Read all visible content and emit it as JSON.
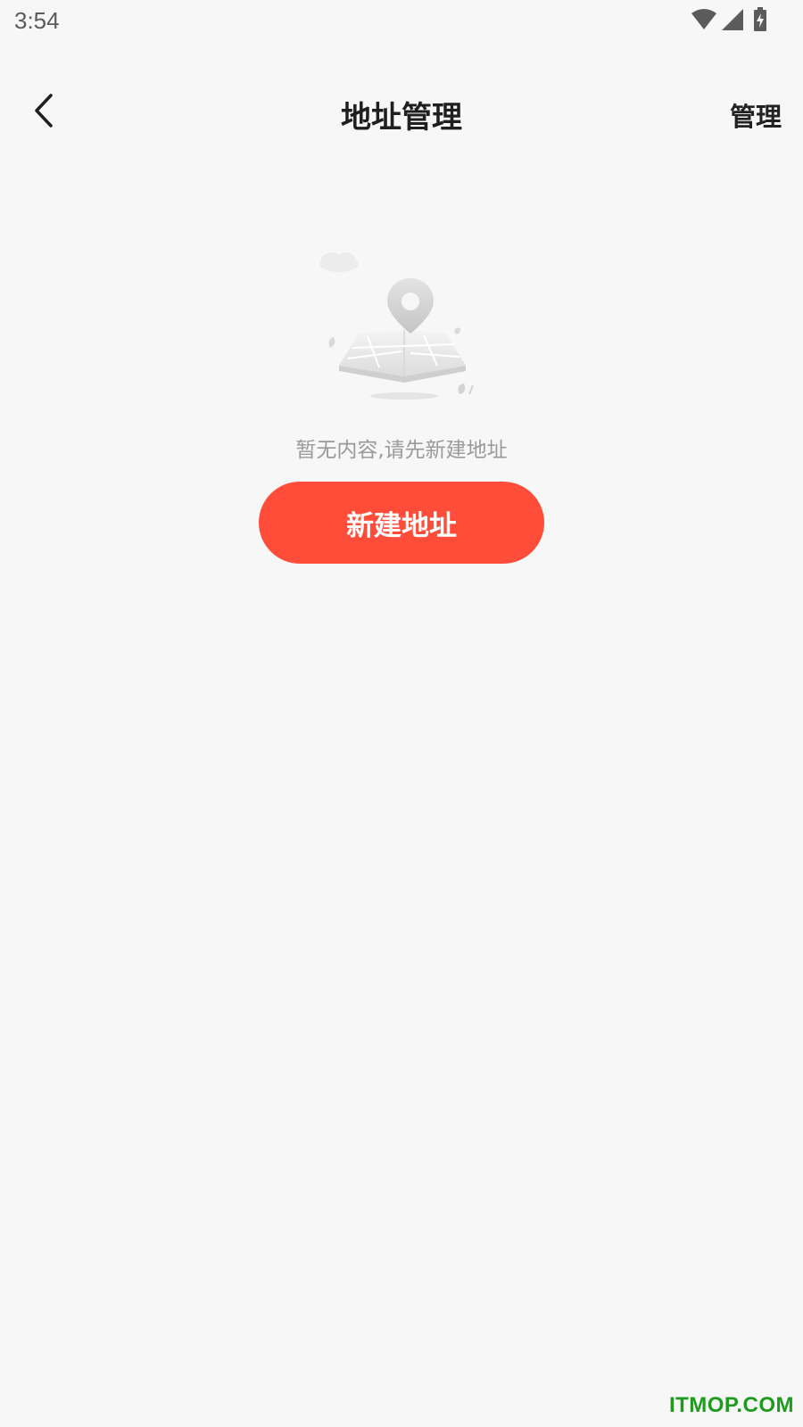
{
  "status_bar": {
    "time": "3:54",
    "icons": [
      "wifi-icon",
      "cellular-signal-icon",
      "battery-charging-icon"
    ]
  },
  "header": {
    "title": "地址管理",
    "manage_label": "管理",
    "back_icon": "back-arrow-icon"
  },
  "empty_state": {
    "illustration": "map-location-pin-illustration",
    "message": "暂无内容,请先新建地址",
    "button_label": "新建地址"
  },
  "watermark": {
    "text": "ITMOP.COM",
    "color": "#1d9b1d"
  },
  "colors": {
    "background": "#f7f7f7",
    "accent": "#ff4d3a"
  }
}
